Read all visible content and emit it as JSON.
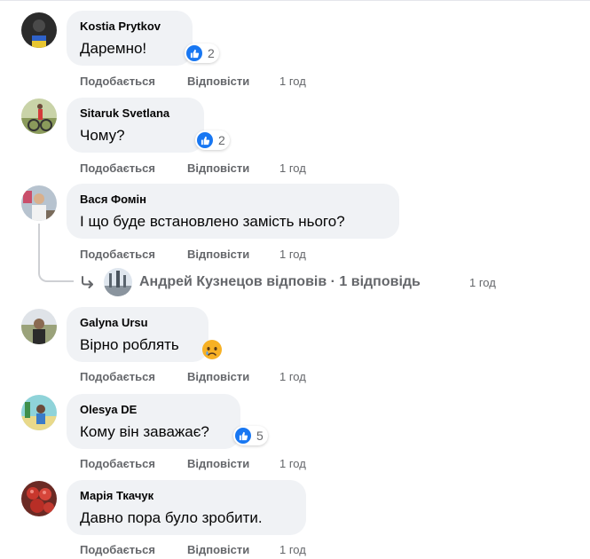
{
  "actions": {
    "like_label": "Подобається",
    "reply_label": "Відповісти"
  },
  "comments": [
    {
      "author": "Kostia Prytkov",
      "text": "Даремно!",
      "time": "1 год",
      "reaction": {
        "icon": "like-icon",
        "count": "2"
      }
    },
    {
      "author": "Sitaruk Svetlana",
      "text": "Чому?",
      "time": "1 год",
      "reaction": {
        "icon": "like-icon",
        "count": "2"
      }
    },
    {
      "author": "Вася Фомін",
      "text": "І що буде встановлено замість нього?",
      "time": "1 год",
      "replies_summary": {
        "text": "Андрей Кузнецов відповів · 1 відповідь",
        "time": "1 год"
      }
    },
    {
      "author": "Galyna Ursu",
      "text": "Вірно роблять",
      "time": "1 год",
      "reaction": {
        "icon": "sad-face-icon"
      }
    },
    {
      "author": "Olesya DE",
      "text": "Кому він заважає?",
      "time": "1 год",
      "reaction": {
        "icon": "like-icon",
        "count": "5"
      }
    },
    {
      "author": "Марія Ткачук",
      "text": "Давно пора було зробити.",
      "time": "1 год"
    }
  ],
  "colors": {
    "bubble_bg": "#f0f2f5",
    "meta_text": "#65676b",
    "like_blue": "#1877f2",
    "body_text": "#050505"
  }
}
